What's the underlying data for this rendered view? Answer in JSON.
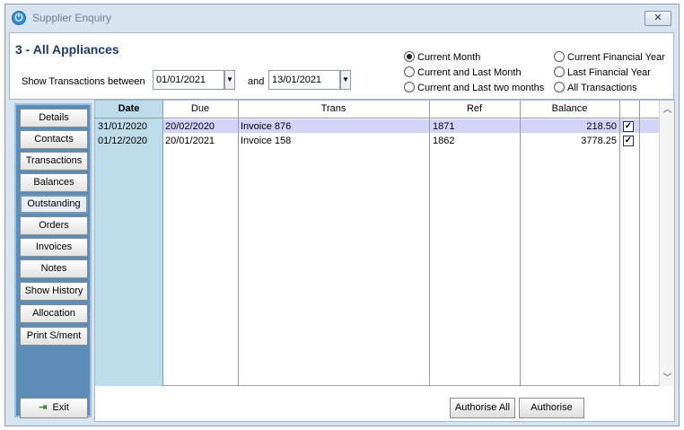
{
  "window": {
    "title": "Supplier Enquiry",
    "close_glyph": "✕",
    "app_icon": "power-icon"
  },
  "header": {
    "heading": "3 - All Appliances",
    "show_label": "Show Transactions between",
    "from_date": "01/01/2021",
    "and_label": "and",
    "to_date": "13/01/2021",
    "period_options": [
      {
        "label": "Current Month",
        "selected": true
      },
      {
        "label": "Current and Last Month",
        "selected": false
      },
      {
        "label": "Current and Last two months",
        "selected": false
      },
      {
        "label": "Current Financial Year",
        "selected": false
      },
      {
        "label": "Last Financial Year",
        "selected": false
      },
      {
        "label": "All Transactions",
        "selected": false
      }
    ]
  },
  "sidebar": {
    "items": [
      {
        "label": "Details"
      },
      {
        "label": "Contacts"
      },
      {
        "label": "Transactions"
      },
      {
        "label": "Balances"
      },
      {
        "label": "Outstanding",
        "active": true
      },
      {
        "label": "Orders"
      },
      {
        "label": "Invoices"
      },
      {
        "label": "Notes"
      },
      {
        "label": "Show History"
      },
      {
        "label": "Allocation"
      },
      {
        "label": "Print S/ment"
      }
    ],
    "exit_label": "Exit"
  },
  "grid": {
    "columns": [
      "Date",
      "Due",
      "Trans",
      "Ref",
      "Balance"
    ],
    "rows": [
      {
        "date": "31/01/2020",
        "due": "20/02/2020",
        "trans": "Invoice 876",
        "ref": "1871",
        "balance": "218.50",
        "checked": true
      },
      {
        "date": "01/12/2020",
        "due": "20/01/2021",
        "trans": "Invoice 158",
        "ref": "1862",
        "balance": "3778.25",
        "checked": true
      }
    ]
  },
  "actions": {
    "authorise_all": "Authorise All",
    "authorise": "Authorise"
  },
  "colors": {
    "window_bg": "#d9e4f1",
    "sidebar_bg": "#5b8db8",
    "date_column": "#bddcec",
    "row_highlight": "#d4d4f8",
    "heading": "#1f3d66"
  }
}
